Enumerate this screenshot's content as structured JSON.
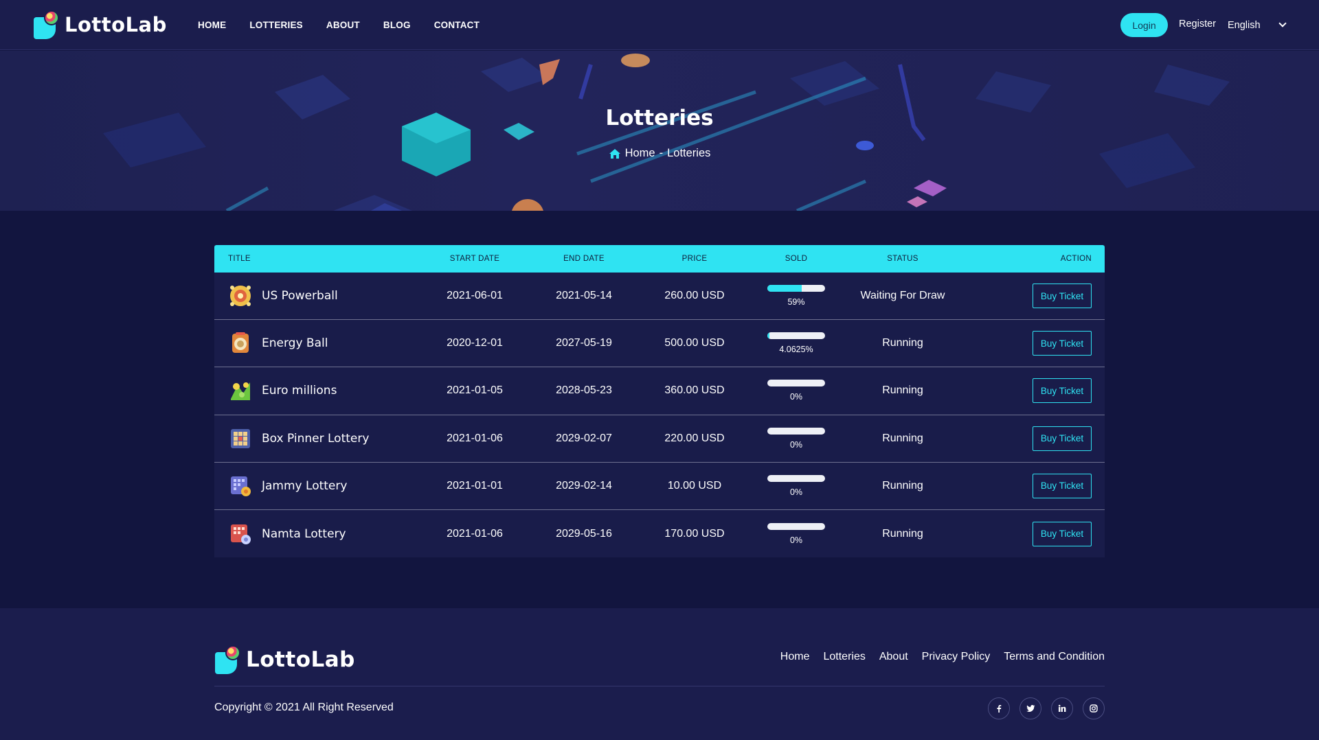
{
  "brand": {
    "name": "LottoLab"
  },
  "nav": {
    "items": [
      "HOME",
      "LOTTERIES",
      "ABOUT",
      "BLOG",
      "CONTACT"
    ],
    "login_label": "Login",
    "register_label": "Register",
    "language": "English"
  },
  "banner": {
    "title": "Lotteries",
    "breadcrumb_home": "Home",
    "breadcrumb_sep": "-",
    "breadcrumb_current": "Lotteries"
  },
  "table": {
    "headers": {
      "title": "TITLE",
      "start": "START DATE",
      "end": "END DATE",
      "price": "PRICE",
      "sold": "SOLD",
      "status": "STATUS",
      "action": "ACTION"
    },
    "rows": [
      {
        "icon": "powerball-icon",
        "name": "US Powerball",
        "start": "2021-06-01",
        "end": "2021-05-14",
        "price": "260.00 USD",
        "sold_label": "59%",
        "sold_fraction": 0.59,
        "status": "Waiting For Draw",
        "action": "Buy Ticket"
      },
      {
        "icon": "energy-ball-icon",
        "name": "Energy Ball",
        "start": "2020-12-01",
        "end": "2027-05-19",
        "price": "500.00 USD",
        "sold_label": "4.0625%",
        "sold_fraction": 0.040625,
        "status": "Running",
        "action": "Buy Ticket"
      },
      {
        "icon": "euro-millions-icon",
        "name": "Euro millions",
        "start": "2021-01-05",
        "end": "2028-05-23",
        "price": "360.00 USD",
        "sold_label": "0%",
        "sold_fraction": 0,
        "status": "Running",
        "action": "Buy Ticket"
      },
      {
        "icon": "box-pinner-icon",
        "name": "Box Pinner Lottery",
        "start": "2021-01-06",
        "end": "2029-02-07",
        "price": "220.00 USD",
        "sold_label": "0%",
        "sold_fraction": 0,
        "status": "Running",
        "action": "Buy Ticket"
      },
      {
        "icon": "jammy-lottery-icon",
        "name": "Jammy Lottery",
        "start": "2021-01-01",
        "end": "2029-02-14",
        "price": "10.00 USD",
        "sold_label": "0%",
        "sold_fraction": 0,
        "status": "Running",
        "action": "Buy Ticket"
      },
      {
        "icon": "namta-lottery-icon",
        "name": "Namta Lottery",
        "start": "2021-01-06",
        "end": "2029-05-16",
        "price": "170.00 USD",
        "sold_label": "0%",
        "sold_fraction": 0,
        "status": "Running",
        "action": "Buy Ticket"
      }
    ]
  },
  "footer": {
    "links": [
      "Home",
      "Lotteries",
      "About",
      "Privacy Policy",
      "Terms and Condition"
    ],
    "copyright": "Copyright © 2021 All Right Reserved",
    "socials": [
      "facebook-icon",
      "twitter-icon",
      "linkedin-icon",
      "instagram-icon"
    ]
  },
  "colors": {
    "accent": "#2fe3f2",
    "page_bg": "#12153f",
    "header_bg": "#1b1d4d",
    "table_bg": "#191c4a"
  }
}
